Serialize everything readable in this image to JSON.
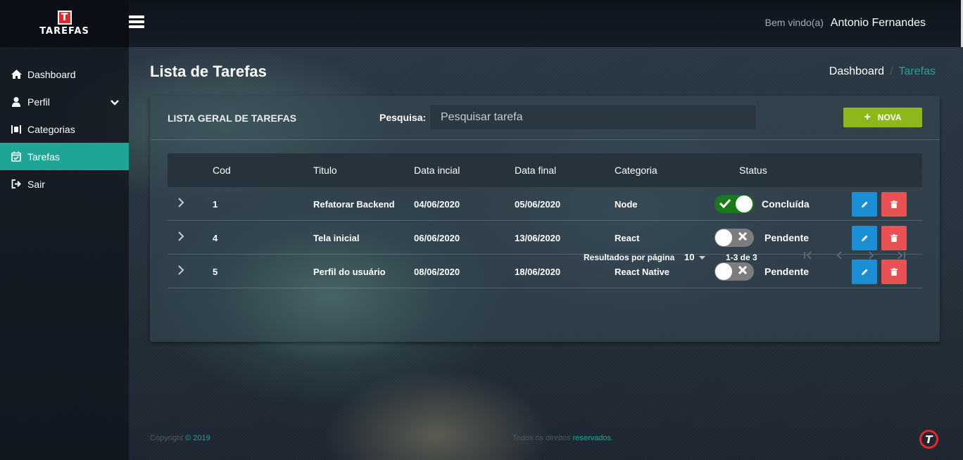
{
  "app": {
    "logo_letter": "T",
    "logo_text": "TAREFAS",
    "welcome_label": "Bem vindo(a)",
    "user_name": "Antonio Fernandes"
  },
  "sidebar": {
    "items": [
      {
        "label": "Dashboard",
        "icon": "home-icon"
      },
      {
        "label": "Perfil",
        "icon": "user-icon"
      },
      {
        "label": "Categorias",
        "icon": "categories-icon"
      },
      {
        "label": "Tarefas",
        "icon": "calendar-check-icon",
        "active": true
      },
      {
        "label": "Sair",
        "icon": "sign-out-icon"
      }
    ]
  },
  "page": {
    "title": "Lista de Tarefas",
    "breadcrumb": [
      "Dashboard",
      "/",
      "Tarefas"
    ]
  },
  "card": {
    "title": "LISTA GERAL DE TAREFAS",
    "search_label": "Pesquisa:",
    "search_placeholder": "Pesquisar tarefa",
    "search_value": "",
    "new_button": "NOVA"
  },
  "table": {
    "headers": [
      "Cod",
      "Titulo",
      "Data incial",
      "Data final",
      "Categoria",
      "Status"
    ],
    "rows": [
      {
        "cod": "1",
        "titulo": "Refatorar Backend",
        "data_inicial": "04/06/2020",
        "data_final": "05/06/2020",
        "categoria": "Node",
        "status": "Concluída",
        "done": true
      },
      {
        "cod": "4",
        "titulo": "Tela inicial",
        "data_inicial": "06/06/2020",
        "data_final": "13/06/2020",
        "categoria": "React",
        "status": "Pendente",
        "done": false
      },
      {
        "cod": "5",
        "titulo": "Perfil do usuário",
        "data_inicial": "08/06/2020",
        "data_final": "18/06/2020",
        "categoria": "React Native",
        "status": "Pendente",
        "done": false
      }
    ]
  },
  "pager": {
    "rows_per_page_label": "Resultados por página",
    "rows_per_page": "10",
    "range": "1-3 de 3"
  },
  "footer": {
    "copyright_label": "Copyright",
    "copyright_year": "© 2019",
    "rights_label": "Todos os direitos",
    "rights_link": "reservados."
  },
  "colors": {
    "accent": "#1fa596",
    "new_button": "#8cb81b",
    "edit_button": "#1a8fd6",
    "delete_button": "#e85252",
    "toggle_on": "#1a7a1a"
  }
}
